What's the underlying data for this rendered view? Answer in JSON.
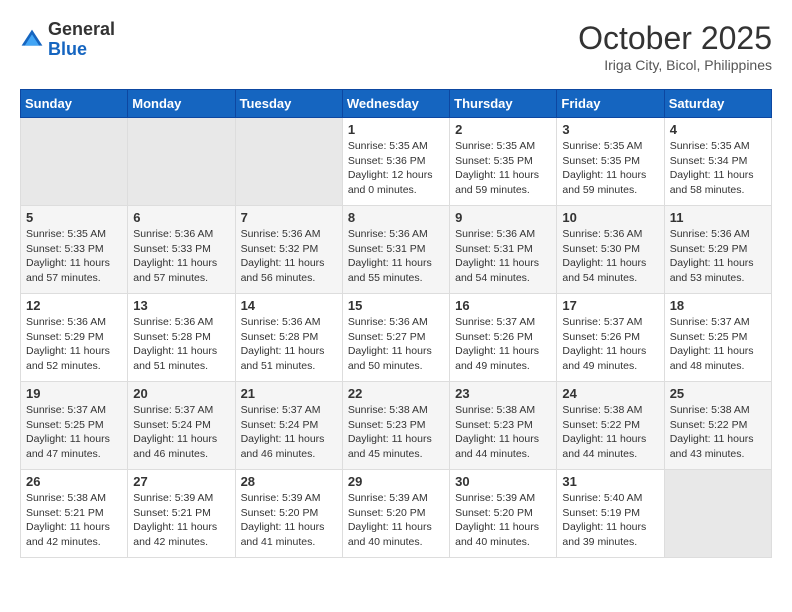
{
  "header": {
    "logo_general": "General",
    "logo_blue": "Blue",
    "month": "October 2025",
    "location": "Iriga City, Bicol, Philippines"
  },
  "days_of_week": [
    "Sunday",
    "Monday",
    "Tuesday",
    "Wednesday",
    "Thursday",
    "Friday",
    "Saturday"
  ],
  "weeks": [
    [
      {
        "day": "",
        "info": ""
      },
      {
        "day": "",
        "info": ""
      },
      {
        "day": "",
        "info": ""
      },
      {
        "day": "1",
        "info": "Sunrise: 5:35 AM\nSunset: 5:36 PM\nDaylight: 12 hours\nand 0 minutes."
      },
      {
        "day": "2",
        "info": "Sunrise: 5:35 AM\nSunset: 5:35 PM\nDaylight: 11 hours\nand 59 minutes."
      },
      {
        "day": "3",
        "info": "Sunrise: 5:35 AM\nSunset: 5:35 PM\nDaylight: 11 hours\nand 59 minutes."
      },
      {
        "day": "4",
        "info": "Sunrise: 5:35 AM\nSunset: 5:34 PM\nDaylight: 11 hours\nand 58 minutes."
      }
    ],
    [
      {
        "day": "5",
        "info": "Sunrise: 5:35 AM\nSunset: 5:33 PM\nDaylight: 11 hours\nand 57 minutes."
      },
      {
        "day": "6",
        "info": "Sunrise: 5:36 AM\nSunset: 5:33 PM\nDaylight: 11 hours\nand 57 minutes."
      },
      {
        "day": "7",
        "info": "Sunrise: 5:36 AM\nSunset: 5:32 PM\nDaylight: 11 hours\nand 56 minutes."
      },
      {
        "day": "8",
        "info": "Sunrise: 5:36 AM\nSunset: 5:31 PM\nDaylight: 11 hours\nand 55 minutes."
      },
      {
        "day": "9",
        "info": "Sunrise: 5:36 AM\nSunset: 5:31 PM\nDaylight: 11 hours\nand 54 minutes."
      },
      {
        "day": "10",
        "info": "Sunrise: 5:36 AM\nSunset: 5:30 PM\nDaylight: 11 hours\nand 54 minutes."
      },
      {
        "day": "11",
        "info": "Sunrise: 5:36 AM\nSunset: 5:29 PM\nDaylight: 11 hours\nand 53 minutes."
      }
    ],
    [
      {
        "day": "12",
        "info": "Sunrise: 5:36 AM\nSunset: 5:29 PM\nDaylight: 11 hours\nand 52 minutes."
      },
      {
        "day": "13",
        "info": "Sunrise: 5:36 AM\nSunset: 5:28 PM\nDaylight: 11 hours\nand 51 minutes."
      },
      {
        "day": "14",
        "info": "Sunrise: 5:36 AM\nSunset: 5:28 PM\nDaylight: 11 hours\nand 51 minutes."
      },
      {
        "day": "15",
        "info": "Sunrise: 5:36 AM\nSunset: 5:27 PM\nDaylight: 11 hours\nand 50 minutes."
      },
      {
        "day": "16",
        "info": "Sunrise: 5:37 AM\nSunset: 5:26 PM\nDaylight: 11 hours\nand 49 minutes."
      },
      {
        "day": "17",
        "info": "Sunrise: 5:37 AM\nSunset: 5:26 PM\nDaylight: 11 hours\nand 49 minutes."
      },
      {
        "day": "18",
        "info": "Sunrise: 5:37 AM\nSunset: 5:25 PM\nDaylight: 11 hours\nand 48 minutes."
      }
    ],
    [
      {
        "day": "19",
        "info": "Sunrise: 5:37 AM\nSunset: 5:25 PM\nDaylight: 11 hours\nand 47 minutes."
      },
      {
        "day": "20",
        "info": "Sunrise: 5:37 AM\nSunset: 5:24 PM\nDaylight: 11 hours\nand 46 minutes."
      },
      {
        "day": "21",
        "info": "Sunrise: 5:37 AM\nSunset: 5:24 PM\nDaylight: 11 hours\nand 46 minutes."
      },
      {
        "day": "22",
        "info": "Sunrise: 5:38 AM\nSunset: 5:23 PM\nDaylight: 11 hours\nand 45 minutes."
      },
      {
        "day": "23",
        "info": "Sunrise: 5:38 AM\nSunset: 5:23 PM\nDaylight: 11 hours\nand 44 minutes."
      },
      {
        "day": "24",
        "info": "Sunrise: 5:38 AM\nSunset: 5:22 PM\nDaylight: 11 hours\nand 44 minutes."
      },
      {
        "day": "25",
        "info": "Sunrise: 5:38 AM\nSunset: 5:22 PM\nDaylight: 11 hours\nand 43 minutes."
      }
    ],
    [
      {
        "day": "26",
        "info": "Sunrise: 5:38 AM\nSunset: 5:21 PM\nDaylight: 11 hours\nand 42 minutes."
      },
      {
        "day": "27",
        "info": "Sunrise: 5:39 AM\nSunset: 5:21 PM\nDaylight: 11 hours\nand 42 minutes."
      },
      {
        "day": "28",
        "info": "Sunrise: 5:39 AM\nSunset: 5:20 PM\nDaylight: 11 hours\nand 41 minutes."
      },
      {
        "day": "29",
        "info": "Sunrise: 5:39 AM\nSunset: 5:20 PM\nDaylight: 11 hours\nand 40 minutes."
      },
      {
        "day": "30",
        "info": "Sunrise: 5:39 AM\nSunset: 5:20 PM\nDaylight: 11 hours\nand 40 minutes."
      },
      {
        "day": "31",
        "info": "Sunrise: 5:40 AM\nSunset: 5:19 PM\nDaylight: 11 hours\nand 39 minutes."
      },
      {
        "day": "",
        "info": ""
      }
    ]
  ]
}
